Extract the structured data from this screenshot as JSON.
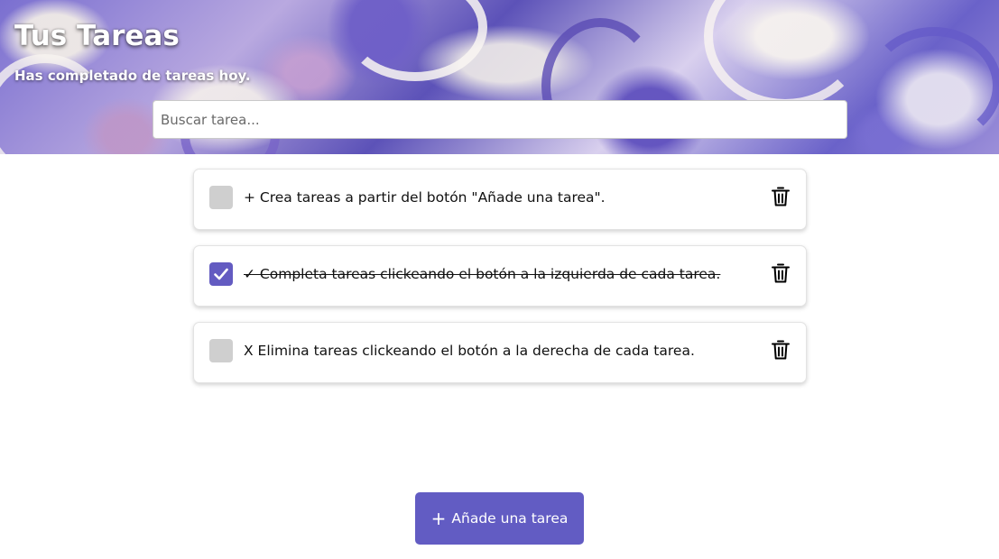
{
  "header": {
    "title": "Tus Tareas",
    "subtitle": "Has completado de tareas hoy."
  },
  "search": {
    "placeholder": "Buscar tarea...",
    "value": ""
  },
  "tasks": [
    {
      "text": "+ Crea tareas a partir del botón \"Añade una tarea\".",
      "completed": false
    },
    {
      "text": "✓ Completa tareas clickeando el botón a la izquierda de cada tarea.",
      "completed": true
    },
    {
      "text": "X Elimina tareas clickeando el botón a la derecha de cada tarea.",
      "completed": false
    }
  ],
  "icons": {
    "check": "check-icon",
    "delete": "trash-icon",
    "add": "plus-icon"
  },
  "add_button": {
    "plus": "+",
    "label": "Añade una tarea"
  },
  "colors": {
    "accent": "#625cc3",
    "unchecked": "#cfcfcf"
  }
}
